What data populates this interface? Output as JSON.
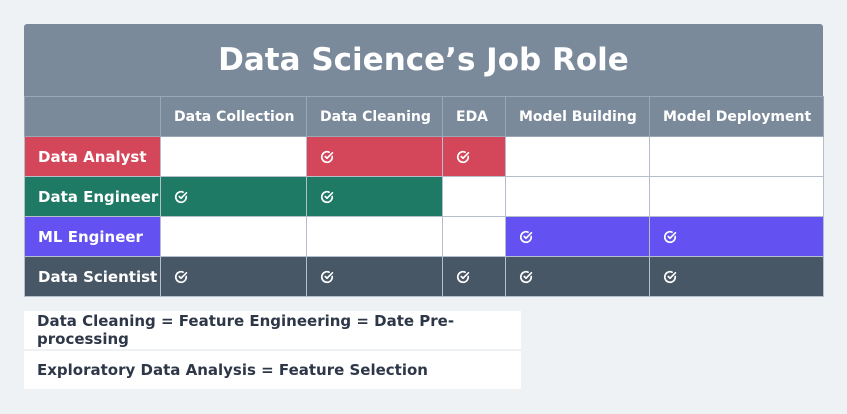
{
  "title": "Data Science’s Job Role",
  "columns": [
    "",
    "Data Collection",
    "Data Cleaning",
    "EDA",
    "Model Building",
    "Model Deployment"
  ],
  "rows": [
    {
      "label": "Data Analyst",
      "color": "#d4475a",
      "checks": [
        false,
        true,
        true,
        false,
        false
      ]
    },
    {
      "label": "Data Engineer",
      "color": "#1f7a65",
      "checks": [
        true,
        true,
        false,
        false,
        false
      ]
    },
    {
      "label": "ML Engineer",
      "color": "#6451f1",
      "checks": [
        false,
        false,
        false,
        true,
        true
      ]
    },
    {
      "label": "Data Scientist",
      "color": "#485766",
      "checks": [
        true,
        true,
        true,
        true,
        true
      ]
    }
  ],
  "check_icon": "check-circle-icon",
  "notes": [
    "Data Cleaning = Feature Engineering = Date Pre-processing",
    "Exploratory Data Analysis = Feature Selection"
  ]
}
